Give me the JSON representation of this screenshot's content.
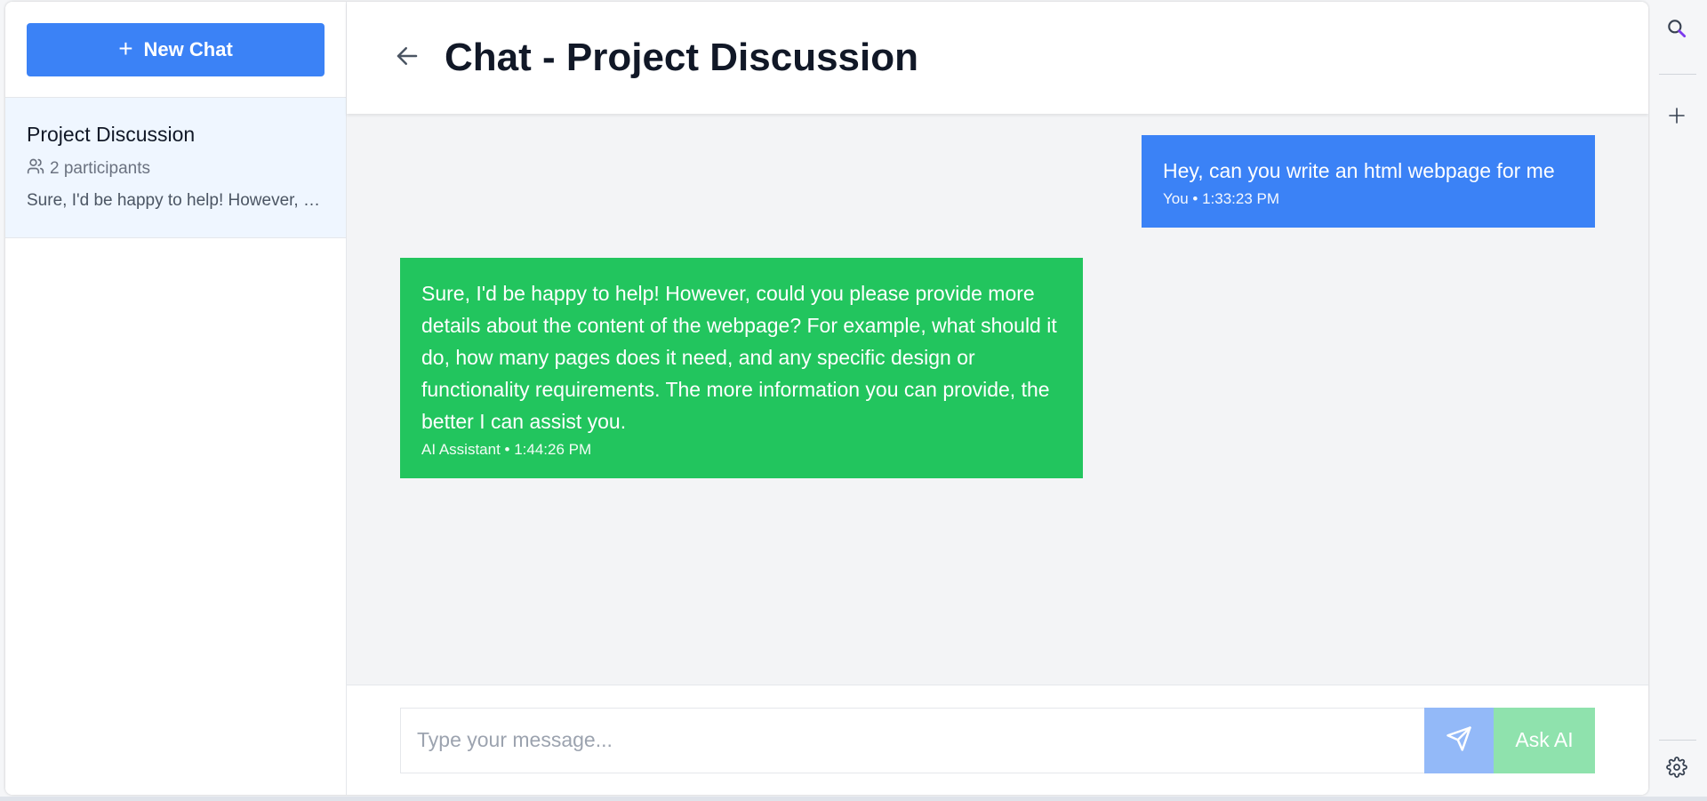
{
  "sidebar": {
    "new_chat_label": "New Chat",
    "conversations": [
      {
        "title": "Project Discussion",
        "participants": "2 participants",
        "preview": "Sure, I'd be happy to help! However, could you please provide more details about the content of the webpage?"
      }
    ]
  },
  "header": {
    "title": "Chat - Project Discussion"
  },
  "messages": [
    {
      "sender": "You",
      "text": "Hey, can you write an html webpage for me",
      "meta": "You • 1:33:23 PM",
      "color": "#3b82f6"
    },
    {
      "sender": "AI Assistant",
      "text": "Sure, I'd be happy to help! However, could you please provide more details about the content of the webpage? For example, what should it do, how many pages does it need, and any specific design or functionality requirements. The more information you can provide, the better I can assist you.",
      "meta": "AI Assistant • 1:44:26 PM",
      "color": "#22c55e"
    }
  ],
  "composer": {
    "placeholder": "Type your message...",
    "value": "",
    "ask_ai_label": "Ask AI"
  },
  "rail": {
    "icons": [
      "search-icon",
      "plus-icon",
      "gear-icon"
    ]
  },
  "colors": {
    "accent": "#3b82f6",
    "ai_bubble": "#22c55e",
    "active_conversation_bg": "#eff6ff"
  }
}
